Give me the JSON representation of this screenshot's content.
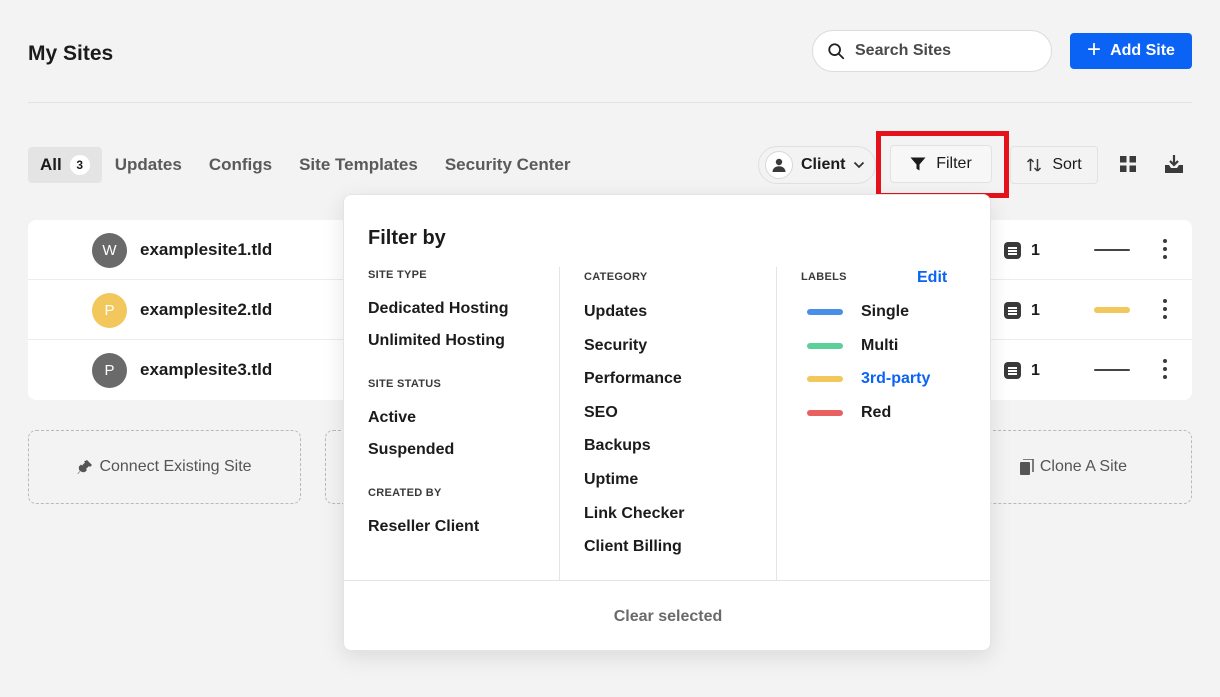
{
  "header": {
    "title": "My Sites",
    "search_placeholder": "Search Sites",
    "add_site_label": "Add Site"
  },
  "tabs": [
    {
      "label": "All",
      "count": "3"
    },
    {
      "label": "Updates"
    },
    {
      "label": "Configs"
    },
    {
      "label": "Site Templates"
    },
    {
      "label": "Security Center"
    }
  ],
  "toolbar": {
    "client_label": "Client",
    "filter_label": "Filter",
    "sort_label": "Sort"
  },
  "sites": [
    {
      "initial": "W",
      "name": "examplesite1.tld",
      "avatar_color": "#6a6a6a",
      "count": "1",
      "label_color": "#444444"
    },
    {
      "initial": "P",
      "name": "examplesite2.tld",
      "avatar_color": "#f2c75c",
      "count": "1",
      "label_color": "#f2c75c"
    },
    {
      "initial": "P",
      "name": "examplesite3.tld",
      "avatar_color": "#6a6a6a",
      "count": "1",
      "label_color": "#444444"
    }
  ],
  "actions": {
    "connect_label": "Connect Existing Site",
    "clone_label": "Clone A Site"
  },
  "filter_panel": {
    "title": "Filter by",
    "site_type": {
      "heading": "SITE TYPE",
      "options": [
        "Dedicated Hosting",
        "Unlimited Hosting"
      ]
    },
    "site_status": {
      "heading": "SITE STATUS",
      "options": [
        "Active",
        "Suspended"
      ]
    },
    "created_by": {
      "heading": "CREATED BY",
      "options": [
        "Reseller Client"
      ]
    },
    "category": {
      "heading": "CATEGORY",
      "options": [
        "Updates",
        "Security",
        "Performance",
        "SEO",
        "Backups",
        "Uptime",
        "Link Checker",
        "Client Billing"
      ]
    },
    "labels": {
      "heading": "LABELS",
      "edit_label": "Edit",
      "items": [
        {
          "name": "Single",
          "color": "#4a8fe7"
        },
        {
          "name": "Multi",
          "color": "#5ccf9a"
        },
        {
          "name": "3rd-party",
          "color": "#f2c75c"
        },
        {
          "name": "Red",
          "color": "#e86060"
        }
      ]
    },
    "clear_label": "Clear selected"
  },
  "colors": {
    "accent": "#0a63f5",
    "highlight": "#e5121b"
  }
}
